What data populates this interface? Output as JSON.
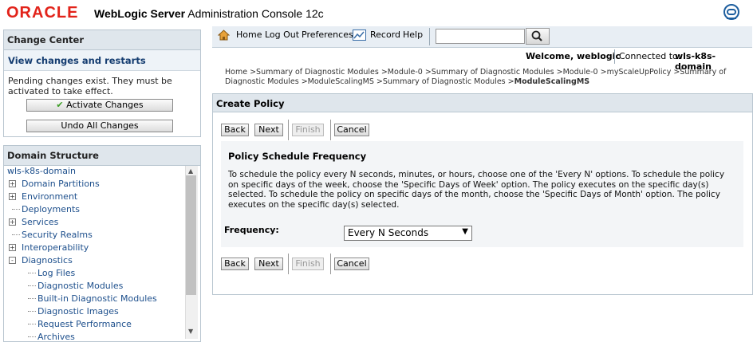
{
  "header": {
    "logo_text": "ORACLE",
    "product_bold": "WebLogic Server",
    "product_rest": "Administration Console 12c"
  },
  "change_center": {
    "title": "Change Center",
    "link": "View changes and restarts",
    "message": "Pending changes exist. They must be activated to take effect.",
    "activate_label": "Activate Changes",
    "undo_label": "Undo All Changes"
  },
  "domain_structure": {
    "title": "Domain Structure",
    "root": "wls-k8s-domain",
    "items": [
      {
        "label": "Domain Partitions",
        "expander": "+"
      },
      {
        "label": "Environment",
        "expander": "+"
      },
      {
        "label": "Deployments",
        "expander": ""
      },
      {
        "label": "Services",
        "expander": "+"
      },
      {
        "label": "Security Realms",
        "expander": ""
      },
      {
        "label": "Interoperability",
        "expander": "+"
      },
      {
        "label": "Diagnostics",
        "expander": "-"
      }
    ],
    "children": [
      "Log Files",
      "Diagnostic Modules",
      "Built-in Diagnostic Modules",
      "Diagnostic Images",
      "Request Performance",
      "Archives"
    ]
  },
  "navbar": {
    "home": "Home",
    "logout": "Log Out",
    "preferences": "Preferences",
    "record": "Record",
    "help": "Help",
    "search_value": ""
  },
  "status": {
    "welcome": "Welcome, weblogic",
    "connected_prefix": "Connected to:",
    "connected_domain": "wls-k8s-domain"
  },
  "breadcrumb": {
    "text": "Home >Summary of Diagnostic Modules >Module-0 >Summary of Diagnostic Modules >Module-0 >myScaleUpPolicy >Summary of Diagnostic Modules >ModuleScalingMS >Summary of Diagnostic Modules >",
    "current": "ModuleScalingMS"
  },
  "create_policy": {
    "title": "Create Policy",
    "back": "Back",
    "next": "Next",
    "finish": "Finish",
    "cancel": "Cancel",
    "section_title": "Policy Schedule Frequency",
    "description": "To schedule the policy every N seconds, minutes, or hours, choose one of the 'Every N' options. To schedule the policy on specific days of the week, choose the 'Specific Days of Week' option. The policy executes on the specific day(s) selected. To schedule the policy on specific days of the month, choose the 'Specific Days of Month' option. The policy executes on the specific day(s) selected.",
    "frequency_label": "Frequency:",
    "frequency_value": "Every N Seconds"
  },
  "colors": {
    "oracle_red": "#e2231a",
    "link_blue": "#1d4f8c",
    "panel_header": "#dfe6ec"
  }
}
